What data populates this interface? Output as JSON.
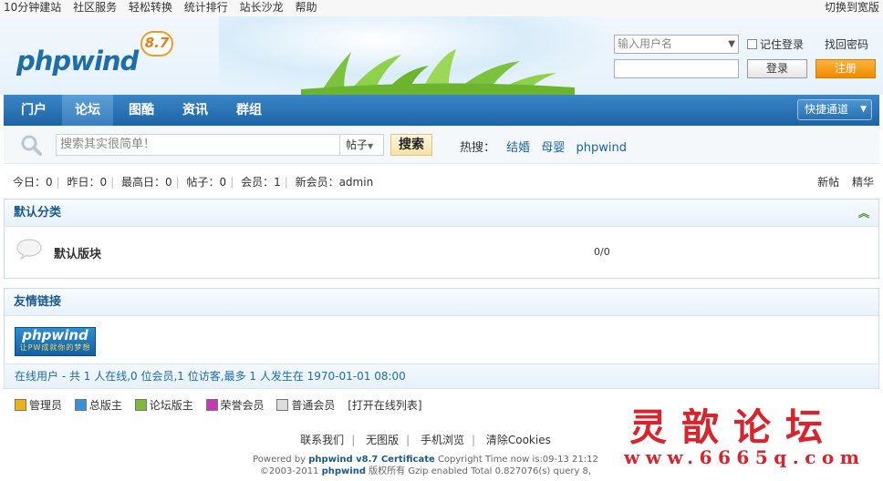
{
  "topbar": {
    "links": [
      "10分钟建站",
      "社区服务",
      "轻松转换",
      "统计排行",
      "站长沙龙",
      "帮助"
    ],
    "wide_label": "切换到宽版"
  },
  "logo": {
    "text": "phpwind",
    "version": "8.7"
  },
  "login": {
    "username_placeholder": "输入用户名",
    "remember_label": "记住登录",
    "find_password": "找回密码",
    "login_label": "登录",
    "register_label": "注册"
  },
  "nav": {
    "items": [
      "门户",
      "论坛",
      "图酷",
      "资讯",
      "群组"
    ],
    "active": "论坛",
    "quick_label": "快捷通道"
  },
  "search": {
    "placeholder": "搜索其实很简单！",
    "type": "帖子",
    "button": "搜索",
    "hot_label": "热搜：",
    "hot_keywords": [
      "结婚",
      "母婴",
      "phpwind"
    ]
  },
  "stats": {
    "items": [
      "今日：0",
      "昨日：0",
      "最高日：0",
      "帖子：0",
      "会员：1",
      "新会员：admin"
    ],
    "right": [
      "新帖",
      "精华"
    ]
  },
  "category": {
    "title": "默认分类",
    "toggle_icon": "collapse-up-icon",
    "forum_name": "默认版块",
    "forum_count": "0/0"
  },
  "links_section": {
    "title": "友情链接",
    "logo_text": "phpwind",
    "logo_sub": "让PW成就你的梦想"
  },
  "online": {
    "text": "在线用户 - 共 1 人在线,0 位会员,1 位访客,最多 1 人发生在 1970-01-01 08:00"
  },
  "legend": {
    "items": [
      {
        "label": "管理员",
        "color": "#e9b21b"
      },
      {
        "label": "总版主",
        "color": "#3a8fd6"
      },
      {
        "label": "论坛版主",
        "color": "#7fb93a"
      },
      {
        "label": "荣誉会员",
        "color": "#c23ab9"
      },
      {
        "label": "普通会员",
        "color": "#dddddd"
      }
    ],
    "open_list": "[打开在线列表]"
  },
  "footer": {
    "links": [
      "联系我们",
      "无图版",
      "手机浏览",
      "清除Cookies"
    ],
    "line1_prefix": "Powered by ",
    "line1_brand": "phpwind v8.7 Certificate",
    "line1_suffix": " Copyright Time now is:09-13 21:12",
    "line2_prefix": "©2003-2011 ",
    "line2_brand": "phpwind",
    "line2_suffix": " 版权所有 Gzip enabled Total 0.827076(s) query 8,"
  },
  "watermark": {
    "text": "灵歆论坛",
    "url": "www.6665q.com"
  }
}
